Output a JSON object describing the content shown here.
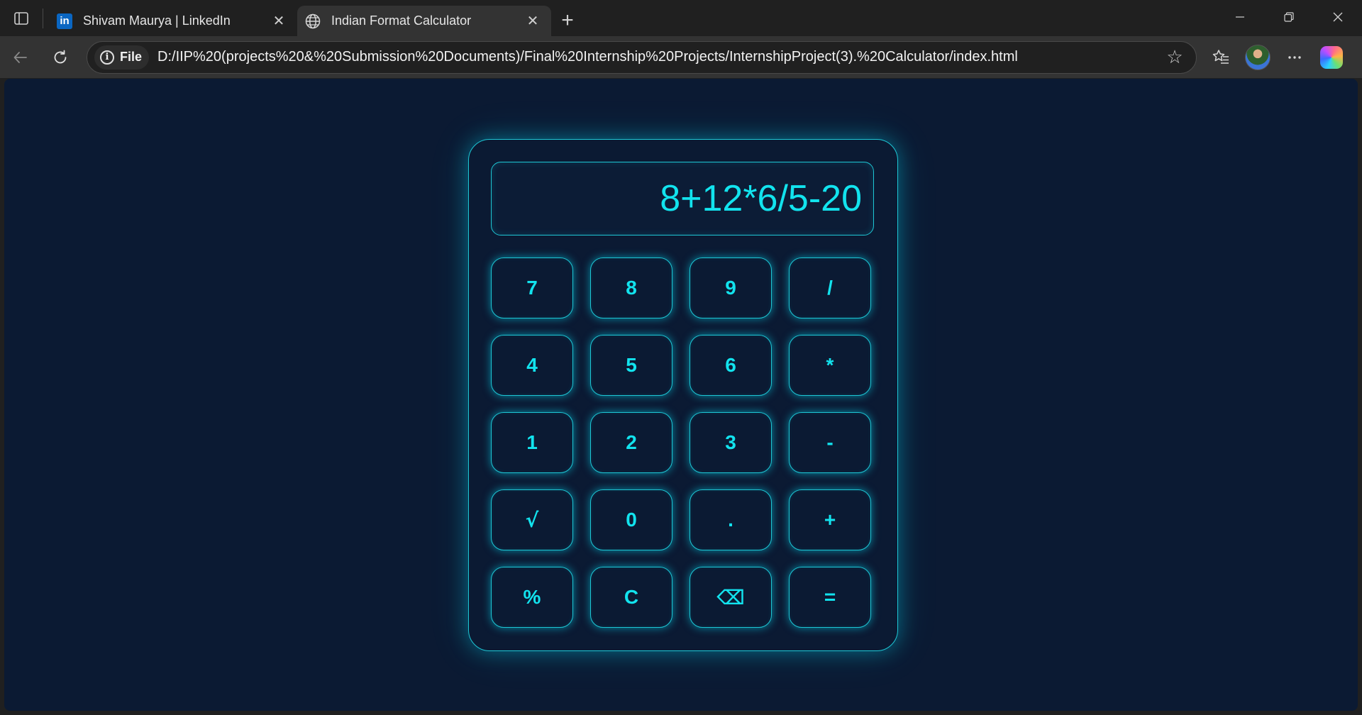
{
  "browser": {
    "tabs": [
      {
        "title": "Shivam Maurya | LinkedIn",
        "icon": "linkedin-icon",
        "active": false
      },
      {
        "title": "Indian Format Calculator",
        "icon": "globe-icon",
        "active": true
      }
    ],
    "address": {
      "scheme_label": "File",
      "url": "D:/IIP%20(projects%20&%20Submission%20Documents)/Final%20Internship%20Projects/InternshipProject(3).%20Calculator/index.html"
    },
    "linkedin_glyph": "in"
  },
  "calculator": {
    "display": "8+12*6/5-20",
    "keys": [
      "7",
      "8",
      "9",
      "/",
      "4",
      "5",
      "6",
      "*",
      "1",
      "2",
      "3",
      "-",
      "√",
      "0",
      ".",
      "+",
      "%",
      "C",
      "⌫",
      "="
    ],
    "accent_color": "#12e3ee",
    "background_color": "#0b1a33"
  }
}
